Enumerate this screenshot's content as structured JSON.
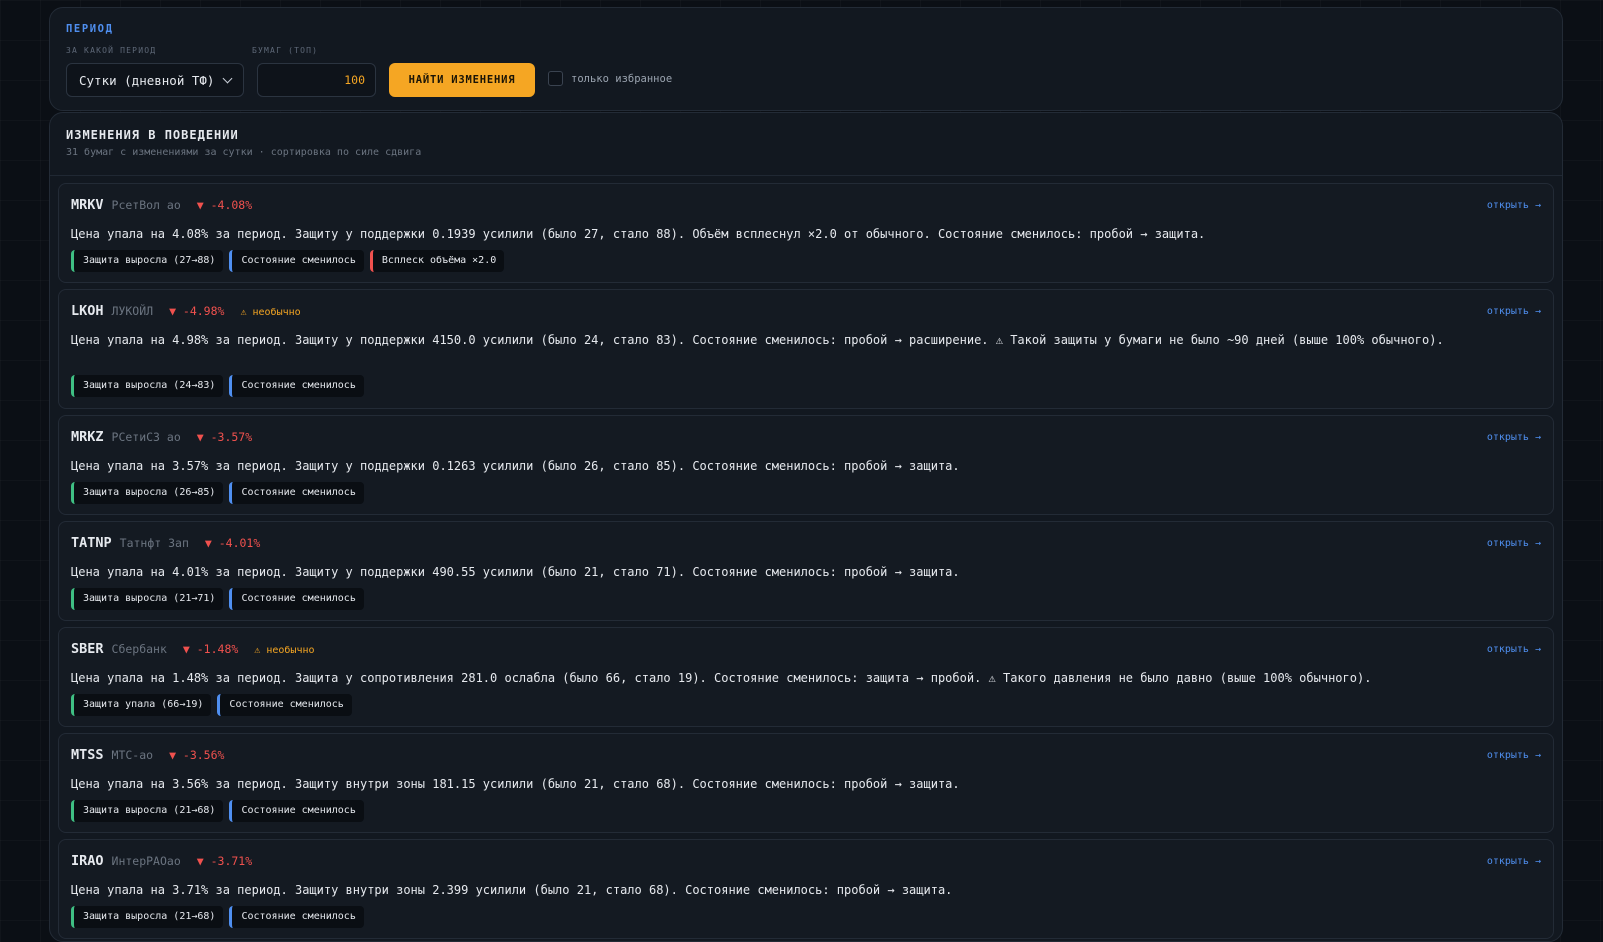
{
  "period": {
    "section_title": "Период",
    "period_label": "за какой период",
    "period_value": "Сутки (дневной ТФ)",
    "top_label": "бумаг (топ)",
    "top_value": "100",
    "find_button": "Найти изменения",
    "favorites_label": "только избранное"
  },
  "changes": {
    "title": "ИЗМЕНЕНИЯ В ПОВЕДЕНИИ",
    "subtitle": "31 бумаг с изменениями за сутки · сортировка по силе сдвига",
    "open_label": "открыть →",
    "items": [
      {
        "ticker": "MRKV",
        "name": "РсетВол ао",
        "change": "▼ -4.08%",
        "unusual": "",
        "description": "Цена упала на 4.08% за период. Защиту у поддержки 0.1939 усилили (было 27, стало 88). Объём всплеснул ×2.0 от обычного. Состояние сменилось: пробой → защита.",
        "tags": [
          {
            "text": "Защита выросла (27→88)",
            "kind": "defense"
          },
          {
            "text": "Состояние сменилось",
            "kind": "state"
          },
          {
            "text": "Всплеск объёма ×2.0",
            "kind": "vol"
          }
        ]
      },
      {
        "ticker": "LKOH",
        "name": "ЛУКОЙЛ",
        "change": "▼ -4.98%",
        "unusual": "⚠ необычно",
        "description": "Цена упала на 4.98% за период. Защиту у поддержки 4150.0 усилили (было 24, стало 83). Состояние сменилось: пробой → расширение. ⚠ Такой защиты у бумаги не было ~90 дней (выше 100% обычного).",
        "tags": [
          {
            "text": "Защита выросла (24→83)",
            "kind": "defense"
          },
          {
            "text": "Состояние сменилось",
            "kind": "state"
          }
        ]
      },
      {
        "ticker": "MRKZ",
        "name": "РСетиСЗ ао",
        "change": "▼ -3.57%",
        "unusual": "",
        "description": "Цена упала на 3.57% за период. Защиту у поддержки 0.1263 усилили (было 26, стало 85). Состояние сменилось: пробой → защита.",
        "tags": [
          {
            "text": "Защита выросла (26→85)",
            "kind": "defense"
          },
          {
            "text": "Состояние сменилось",
            "kind": "state"
          }
        ]
      },
      {
        "ticker": "TATNP",
        "name": "Татнфт 3ап",
        "change": "▼ -4.01%",
        "unusual": "",
        "description": "Цена упала на 4.01% за период. Защиту у поддержки 490.55 усилили (было 21, стало 71). Состояние сменилось: пробой → защита.",
        "tags": [
          {
            "text": "Защита выросла (21→71)",
            "kind": "defense"
          },
          {
            "text": "Состояние сменилось",
            "kind": "state"
          }
        ]
      },
      {
        "ticker": "SBER",
        "name": "Сбербанк",
        "change": "▼ -1.48%",
        "unusual": "⚠ необычно",
        "description": "Цена упала на 1.48% за период. Защита у сопротивления 281.0 ослабла (было 66, стало 19). Состояние сменилось: защита → пробой. ⚠ Такого давления не было давно (выше 100% обычного).",
        "tags": [
          {
            "text": "Защита упала (66→19)",
            "kind": "defense"
          },
          {
            "text": "Состояние сменилось",
            "kind": "state"
          }
        ]
      },
      {
        "ticker": "MTSS",
        "name": "МТС-ао",
        "change": "▼ -3.56%",
        "unusual": "",
        "description": "Цена упала на 3.56% за период. Защиту внутри зоны 181.15 усилили (было 21, стало 68). Состояние сменилось: пробой → защита.",
        "tags": [
          {
            "text": "Защита выросла (21→68)",
            "kind": "defense"
          },
          {
            "text": "Состояние сменилось",
            "kind": "state"
          }
        ]
      },
      {
        "ticker": "IRAO",
        "name": "ИнтерРАОао",
        "change": "▼ -3.71%",
        "unusual": "",
        "description": "Цена упала на 3.71% за период. Защиту внутри зоны 2.399 усилили (было 21, стало 68). Состояние сменилось: пробой → защита.",
        "tags": [
          {
            "text": "Защита выросла (21→68)",
            "kind": "defense"
          },
          {
            "text": "Состояние сменилось",
            "kind": "state"
          }
        ]
      }
    ]
  },
  "colors": {
    "accent": "#f5a623",
    "link": "#4f8ff0",
    "negative": "#f0514e",
    "tag_defense": "#3fbf83",
    "tag_state": "#4f8ff0",
    "tag_volume": "#f0514e"
  }
}
